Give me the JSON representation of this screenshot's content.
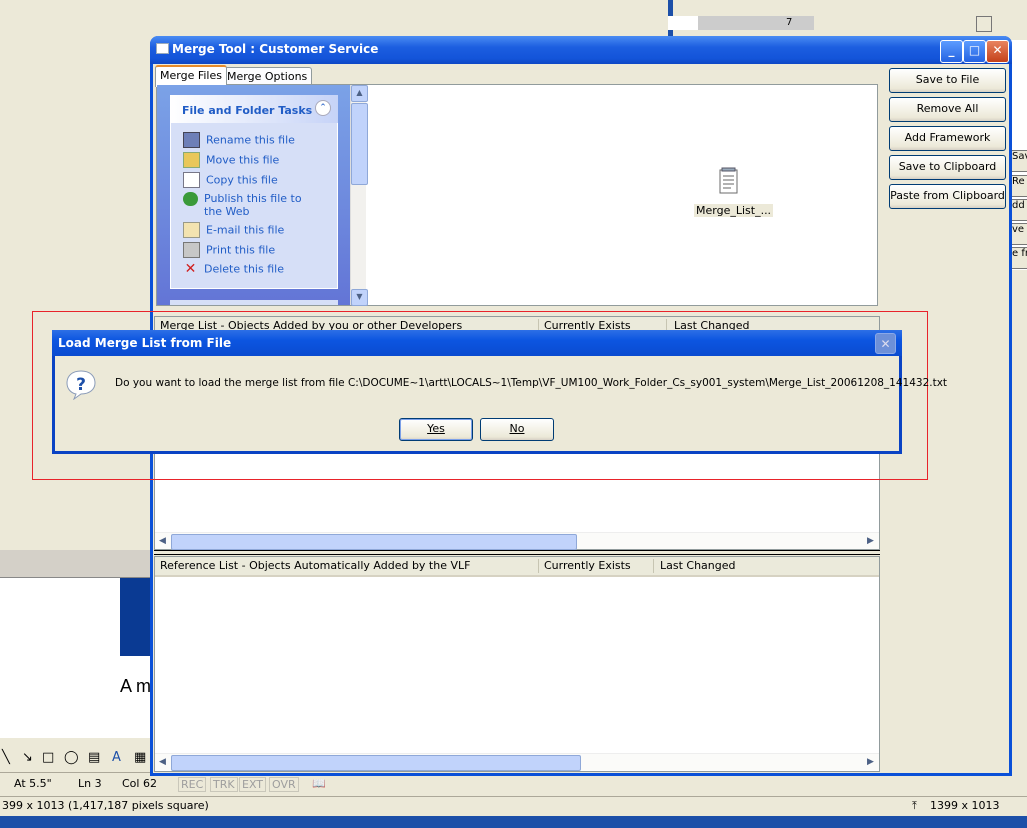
{
  "background": {
    "doc_text": "A m",
    "ruler_number": "7",
    "right_buttons": [
      "Sav",
      "Re",
      "dd F",
      "ve t",
      "e fr"
    ],
    "status_bar": {
      "at": "At 5.5\"",
      "ln": "Ln 3",
      "col": "Col 62",
      "rec": "REC",
      "trk": "TRK",
      "ext": "EXT",
      "ovr": "OVR"
    },
    "bottom_status_left": "399 x 1013 (1,417,187 pixels square)",
    "bottom_status_right": "1399 x 1013"
  },
  "window": {
    "title": "Merge Tool : Customer Service",
    "tabs": [
      "Merge Files",
      "Merge Options"
    ],
    "tasks": {
      "title": "File and Folder Tasks",
      "items": [
        "Rename this file",
        "Move this file",
        "Copy this file",
        "Publish this file to the Web",
        "E-mail this file",
        "Print this file",
        "Delete this file"
      ]
    },
    "file_name": "Merge_List_...",
    "side_buttons": [
      "Save to File",
      "Remove All",
      "Add Framework",
      "Save to Clipboard",
      "Paste from Clipboard"
    ],
    "merge_list": {
      "columns": [
        "Merge List - Objects Added by you or other Developers",
        "Currently Exists",
        "Last Changed"
      ]
    },
    "reference_list": {
      "columns": [
        "Reference List -  Objects Automatically Added by the VLF",
        "Currently Exists",
        "Last Changed"
      ]
    }
  },
  "dialog": {
    "title": "Load Merge List from File",
    "message": "Do you want to load the merge list from file C:\\DOCUME~1\\artt\\LOCALS~1\\Temp\\VF_UM100_Work_Folder_Cs_sy001_system\\Merge_List_20061208_141432.txt",
    "yes_label": "Yes",
    "no_label": "No"
  },
  "colors": {
    "titlebar": "#0a50d8",
    "highlight": "#e8232a",
    "task_link": "#215dc6"
  }
}
